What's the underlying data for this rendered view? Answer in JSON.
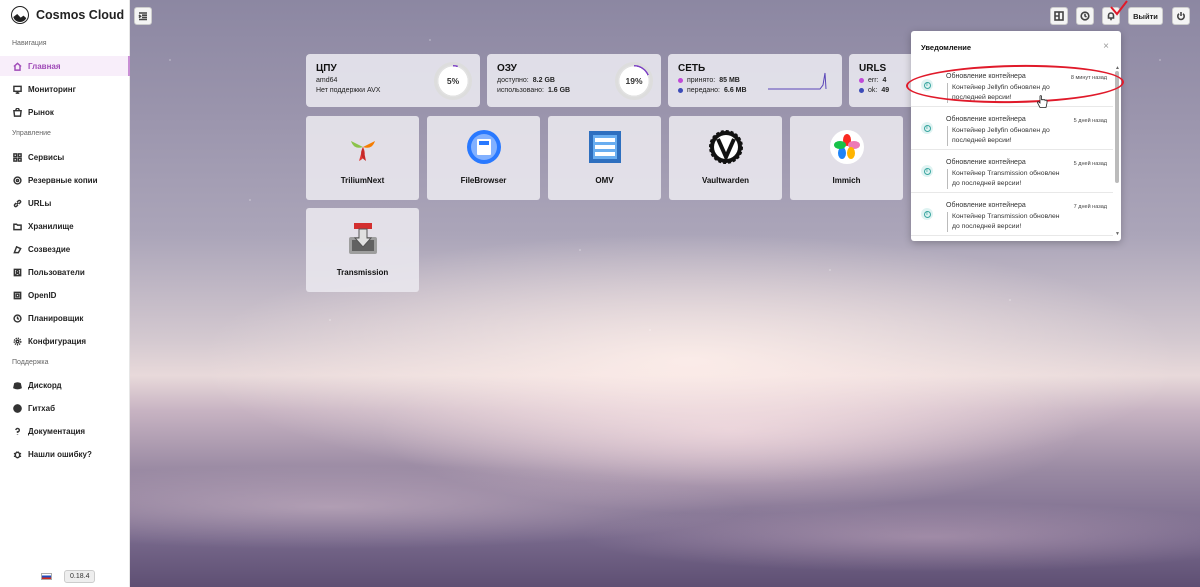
{
  "app": {
    "title": "Cosmos Cloud",
    "version": "0.18.4"
  },
  "sidebar": {
    "sections": [
      {
        "title": "Навигация",
        "items": [
          {
            "label": "Главная",
            "icon": "home-icon",
            "active": true
          },
          {
            "label": "Мониторинг",
            "icon": "monitor-icon"
          },
          {
            "label": "Рынок",
            "icon": "store-icon"
          }
        ]
      },
      {
        "title": "Управление",
        "items": [
          {
            "label": "Сервисы",
            "icon": "grid-icon"
          },
          {
            "label": "Резервные копии",
            "icon": "backup-icon"
          },
          {
            "label": "URLы",
            "icon": "link-icon"
          },
          {
            "label": "Хранилище",
            "icon": "folder-icon"
          },
          {
            "label": "Созвездие",
            "icon": "constellation-icon"
          },
          {
            "label": "Пользователи",
            "icon": "users-icon"
          },
          {
            "label": "OpenID",
            "icon": "openid-icon"
          },
          {
            "label": "Планировщик",
            "icon": "clock-icon"
          },
          {
            "label": "Конфигурация",
            "icon": "gear-icon"
          }
        ]
      },
      {
        "title": "Поддержка",
        "items": [
          {
            "label": "Дискорд",
            "icon": "discord-icon"
          },
          {
            "label": "Гитхаб",
            "icon": "github-icon"
          },
          {
            "label": "Документация",
            "icon": "question-icon"
          },
          {
            "label": "Нашли ошибку?",
            "icon": "bug-icon"
          }
        ]
      }
    ]
  },
  "topbar": {
    "logout_label": "Выйти"
  },
  "stats": {
    "cpu": {
      "title": "ЦПУ",
      "line1": "amd64",
      "line2": "Нет поддержки AVX",
      "percent": "5%",
      "fraction": 0.05
    },
    "ram": {
      "title": "ОЗУ",
      "available_label": "доступно:",
      "available": "8.2 GB",
      "used_label": "использовано:",
      "used": "1.6 GB",
      "percent": "19%",
      "fraction": 0.19
    },
    "net": {
      "title": "СЕТЬ",
      "received_label": "принято:",
      "received": "85 MB",
      "sent_label": "передано:",
      "sent": "6.6 MB"
    },
    "urls": {
      "title": "URLS",
      "err_label": "err:",
      "err": "4",
      "ok_label": "ok:",
      "ok": "49"
    }
  },
  "apps": [
    {
      "label": "TriliumNext",
      "icon": "trilium-icon"
    },
    {
      "label": "FileBrowser",
      "icon": "filebrowser-icon"
    },
    {
      "label": "OMV",
      "icon": "omv-icon"
    },
    {
      "label": "Vaultwarden",
      "icon": "vaultwarden-icon"
    },
    {
      "label": "Immich",
      "icon": "immich-icon"
    },
    {
      "label": "Transmission",
      "icon": "transmission-icon"
    }
  ],
  "notifications": {
    "title": "Уведомление",
    "items": [
      {
        "title": "Обновление контейнера",
        "time": "8 минут назад",
        "body": "Контейнер Jellyfin обновлен до последней версии!"
      },
      {
        "title": "Обновление контейнера",
        "time": "5 дней назад",
        "body": "Контейнер Jellyfin обновлен до последней версии!"
      },
      {
        "title": "Обновление контейнера",
        "time": "5 дней назад",
        "body": "Контейнер Transmission обновлен до последней версии!"
      },
      {
        "title": "Обновление контейнера",
        "time": "7 дней назад",
        "body": "Контейнер Transmission обновлен до последней версии!"
      }
    ]
  },
  "colors": {
    "accent": "#a04bb8",
    "received_dot": "#c04ad8",
    "sent_dot": "#3c4bb8",
    "highlight": "#e01a2a"
  }
}
